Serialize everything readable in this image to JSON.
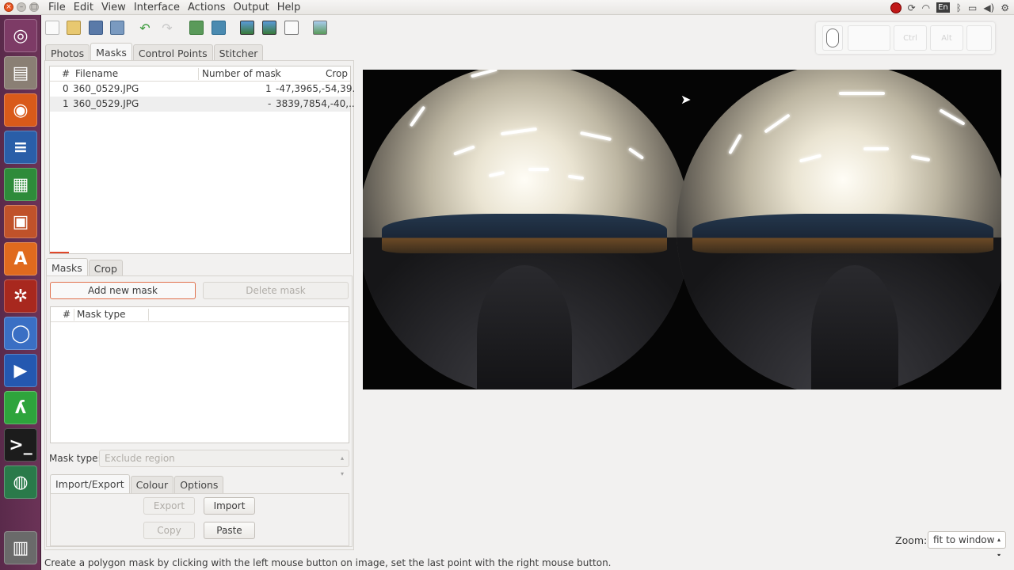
{
  "menu": {
    "items": [
      "File",
      "Edit",
      "View",
      "Interface",
      "Actions",
      "Output",
      "Help"
    ]
  },
  "system_tray": {
    "keyboard_layout": "En"
  },
  "main_tabs": [
    "Photos",
    "Masks",
    "Control Points",
    "Stitcher"
  ],
  "image_list": {
    "columns": [
      "#",
      "Filename",
      "Number of mask",
      "Crop"
    ],
    "rows": [
      {
        "index": "0",
        "filename": "360_0529.JPG",
        "masks": "1",
        "crop": "-47,3965,-54,39..."
      },
      {
        "index": "1",
        "filename": "360_0529.JPG",
        "masks": "-",
        "crop": "3839,7854,-40,..."
      }
    ]
  },
  "sub_tabs": [
    "Masks",
    "Crop"
  ],
  "mask_buttons": {
    "add": "Add new mask",
    "delete": "Delete mask"
  },
  "mask_list": {
    "columns": [
      "#",
      "Mask type"
    ]
  },
  "mask_type": {
    "label": "Mask type:",
    "value": "Exclude region"
  },
  "bottom_tabs": [
    "Import/Export",
    "Colour",
    "Options"
  ],
  "ie_buttons": {
    "export": "Export",
    "import": "Import",
    "copy": "Copy",
    "paste": "Paste"
  },
  "zoom": {
    "label": "Zoom:",
    "value": "fit to window"
  },
  "keyboard_indicator": {
    "ctrl": "Ctrl",
    "alt": "Alt"
  },
  "status": "Create a polygon mask by clicking with the left mouse button on image, set the last point with the right mouse button."
}
